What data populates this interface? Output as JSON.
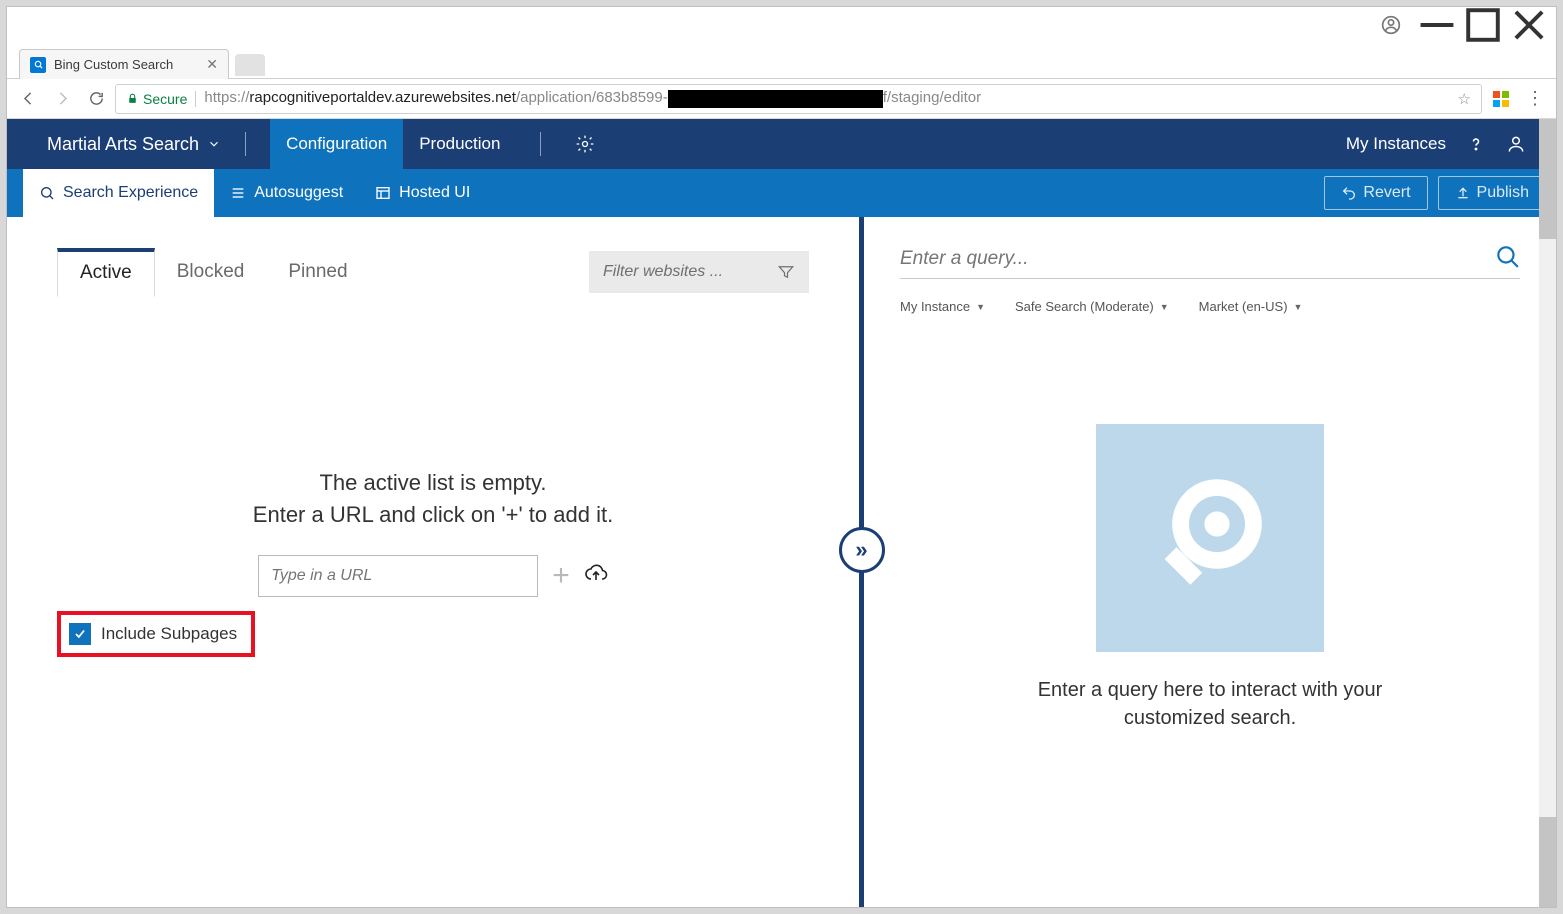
{
  "browser": {
    "tab_title": "Bing Custom Search",
    "url_prefix": "https://",
    "url_host": "rapcognitiveportaldev.azurewebsites.net",
    "url_path_before": "/application/683b8599-",
    "url_path_after": "f/staging/editor",
    "secure_label": "Secure"
  },
  "top_nav": {
    "instance_name": "Martial Arts Search",
    "configuration": "Configuration",
    "production": "Production",
    "my_instances": "My Instances"
  },
  "sub_nav": {
    "search_experience": "Search Experience",
    "autosuggest": "Autosuggest",
    "hosted_ui": "Hosted UI",
    "revert": "Revert",
    "publish": "Publish"
  },
  "tabs": {
    "active": "Active",
    "blocked": "Blocked",
    "pinned": "Pinned"
  },
  "filter_placeholder": "Filter websites ...",
  "empty": {
    "line1": "The active list is empty.",
    "line2": "Enter a URL and click on '+' to add it.",
    "url_placeholder": "Type in a URL",
    "include_subpages": "Include Subpages"
  },
  "right": {
    "query_placeholder": "Enter a query...",
    "dd_instance": "My Instance",
    "dd_safesearch": "Safe Search (Moderate)",
    "dd_market": "Market (en-US)",
    "preview_line1": "Enter a query here to interact with your",
    "preview_line2": "customized search."
  }
}
